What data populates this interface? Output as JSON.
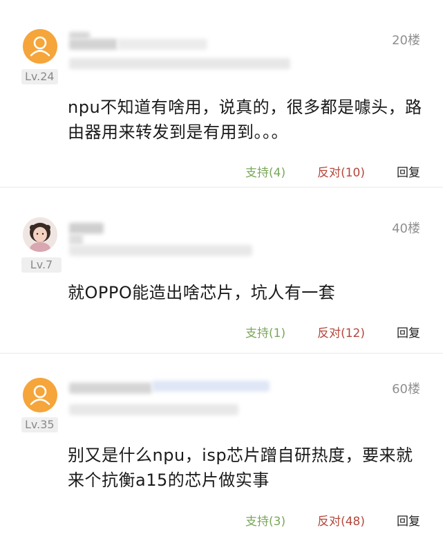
{
  "comments": [
    {
      "level": "Lv.24",
      "floor": "20楼",
      "text": "npu不知道有啥用，说真的，很多都是噱头，路由器用来转发到是有用到。。。",
      "support": "支持(4)",
      "oppose": "反对(10)",
      "reply": "回复",
      "avatar": "default-user-icon"
    },
    {
      "level": "Lv.7",
      "floor": "40楼",
      "text": "就OPPO能造出啥芯片，坑人有一套",
      "support": "支持(1)",
      "oppose": "反对(12)",
      "reply": "回复",
      "avatar": "photo"
    },
    {
      "level": "Lv.35",
      "floor": "60楼",
      "text": "别又是什么npu，isp芯片蹭自研热度，要来就来个抗衡a15的芯片做实事",
      "support": "支持(3)",
      "oppose": "反对(48)",
      "reply": "回复",
      "avatar": "default-user-icon"
    }
  ],
  "colors": {
    "support": "#79a65a",
    "oppose": "#b4473b",
    "avatar_default": "#f5a53a"
  }
}
